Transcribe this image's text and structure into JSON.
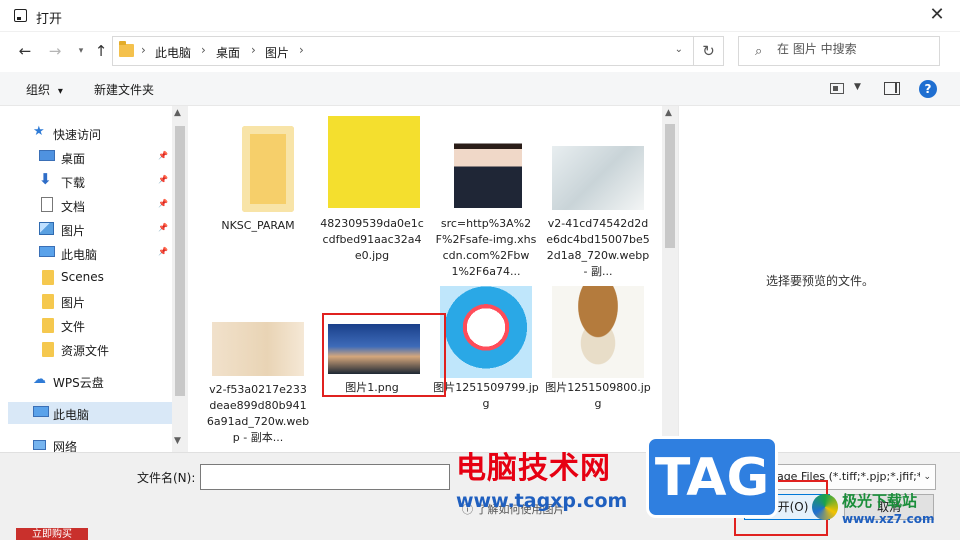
{
  "window": {
    "title": "打开",
    "close_glyph": "✕"
  },
  "address": {
    "crumbs": [
      "此电脑",
      "桌面",
      "图片"
    ],
    "separator": "›",
    "search_placeholder": "在 图片 中搜索"
  },
  "toolbar": {
    "organize_label": "组织",
    "organize_arrow": "▾",
    "new_folder_label": "新建文件夹",
    "help_label": "?"
  },
  "nav": {
    "items": [
      {
        "label": "快速访问",
        "icon": "star-icon",
        "pinned": false
      },
      {
        "label": "桌面",
        "icon": "desktop-icon",
        "pinned": true
      },
      {
        "label": "下载",
        "icon": "download-icon",
        "pinned": true
      },
      {
        "label": "文档",
        "icon": "document-icon",
        "pinned": true
      },
      {
        "label": "图片",
        "icon": "pictures-icon",
        "pinned": true
      },
      {
        "label": "此电脑",
        "icon": "computer-icon",
        "pinned": true
      },
      {
        "label": "Scenes",
        "icon": "folder-icon",
        "pinned": false
      },
      {
        "label": "图片",
        "icon": "folder-icon",
        "pinned": false
      },
      {
        "label": "文件",
        "icon": "folder-icon",
        "pinned": false
      },
      {
        "label": "资源文件",
        "icon": "folder-icon",
        "pinned": false
      },
      {
        "label": "WPS云盘",
        "icon": "cloud-icon",
        "pinned": false
      },
      {
        "label": "此电脑",
        "icon": "computer-icon",
        "pinned": false,
        "selected": true
      },
      {
        "label": "网络",
        "icon": "network-icon",
        "pinned": false
      }
    ]
  },
  "files": [
    {
      "name": "NKSC_PARAM",
      "kind": "folder"
    },
    {
      "name": "482309539da0e1ccdfbed91aac32a4e0.jpg",
      "kind": "spongebob"
    },
    {
      "name": "src=http%3A%2F%2Fsafe-img.xhscdn.com%2Fbw1%2F6a74...",
      "kind": "portrait"
    },
    {
      "name": "v2-41cd74542d2de6dc4bd15007be52d1a8_720w.webp - 副...",
      "kind": "photo-white"
    },
    {
      "name": "v2-f53a0217e233deae899d80b9416a91ad_720w.webp - 副本...",
      "kind": "bottle"
    },
    {
      "name": "图片1.png",
      "kind": "city"
    },
    {
      "name": "图片1251509799.jpg",
      "kind": "doraemon"
    },
    {
      "name": "图片1251509800.jpg",
      "kind": "cat-burger"
    }
  ],
  "preview": {
    "empty_text": "选择要预览的文件。"
  },
  "bottom": {
    "filename_label": "文件名(N):",
    "filename_value": "",
    "filetype_value": "Image Files (*.tiff;*.pjp;*.jfif;*.",
    "open_label": "打开(O)",
    "cancel_label": "取消",
    "help_link": "了解如何使用图片"
  },
  "watermarks": {
    "cn_text": "电脑技术网",
    "url": "www.tagxp.com",
    "tag": "TAG",
    "aurora_text": "极光下载站",
    "aurora_site": "www.xz7.com",
    "badge": "立即购买"
  },
  "colors": {
    "accent": "#0078d7",
    "selection": "#d9e8f7",
    "highlight_red": "#e0211f"
  }
}
